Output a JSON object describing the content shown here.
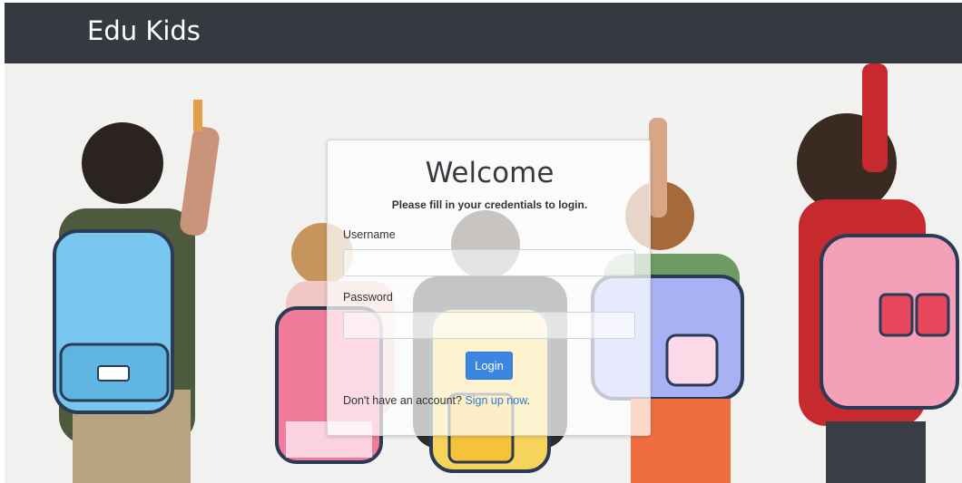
{
  "navbar": {
    "brand": "Edu Kids"
  },
  "login": {
    "title": "Welcome",
    "subtitle": "Please fill in your credentials to login.",
    "username_label": "Username",
    "username_value": "",
    "password_label": "Password",
    "password_value": "",
    "login_button": "Login",
    "signup_prompt": "Don't have an account?",
    "signup_link": "Sign up now",
    "signup_suffix": "."
  },
  "colors": {
    "navbar_bg": "#343a40",
    "button_bg": "#3a86e0",
    "link": "#2f79cf"
  }
}
